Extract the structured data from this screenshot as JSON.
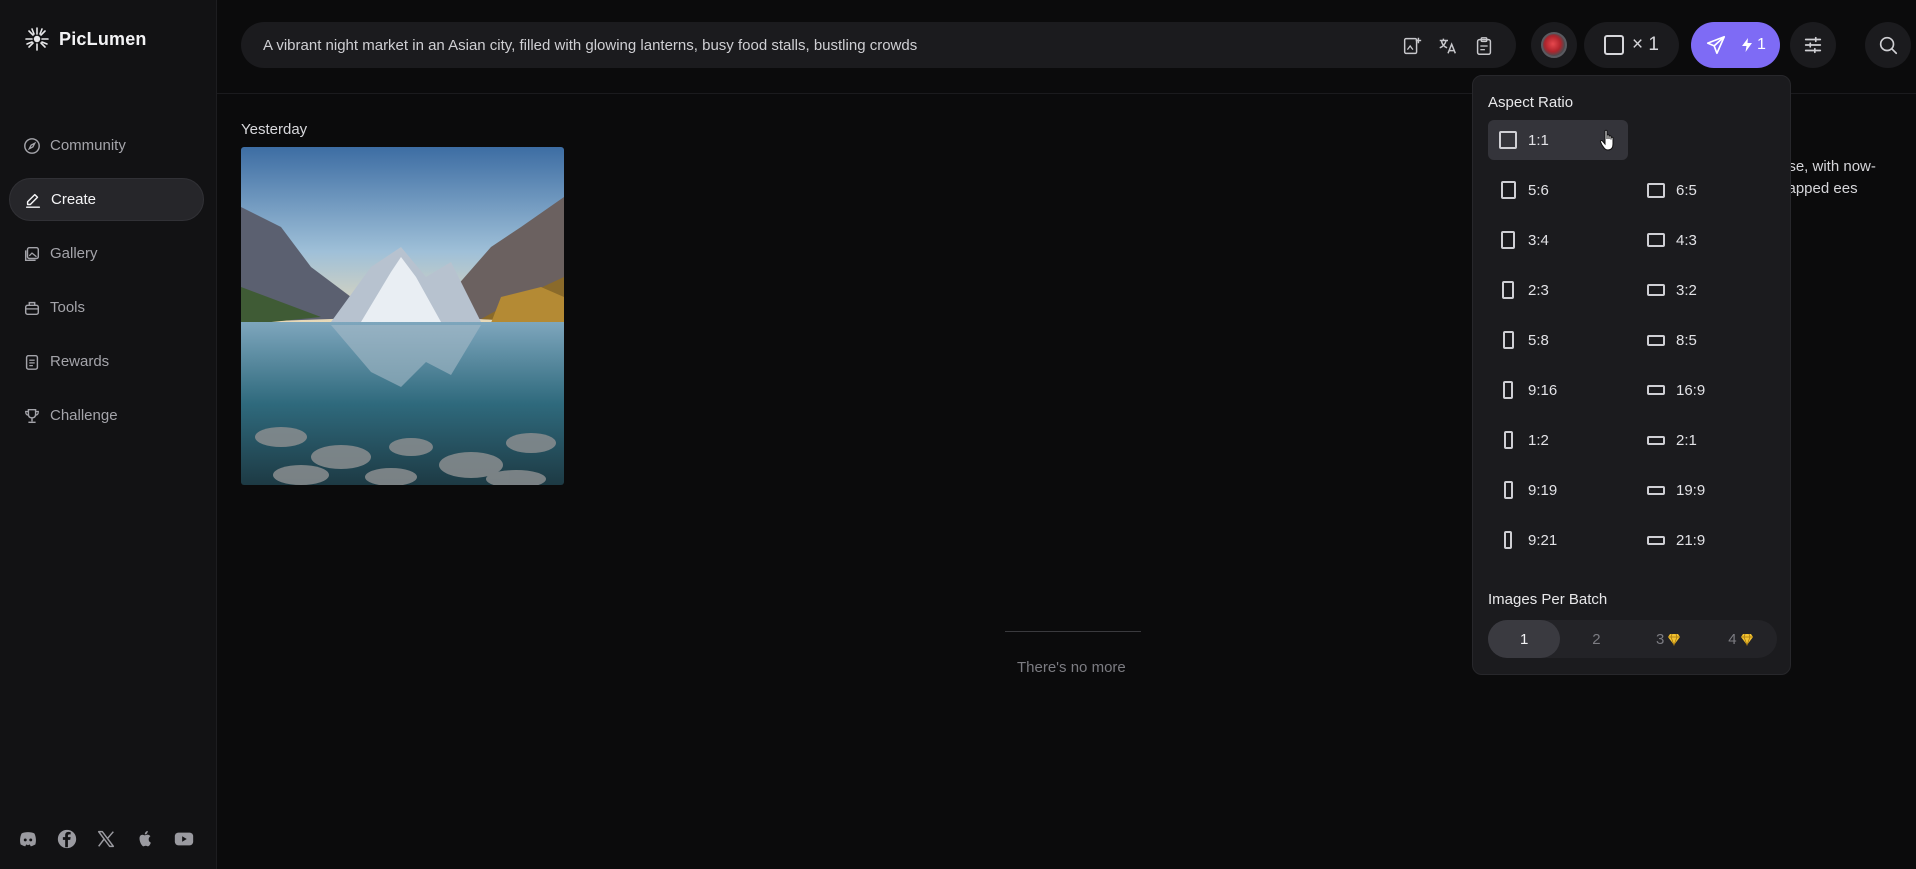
{
  "app": {
    "name": "PicLumen"
  },
  "sidebar": {
    "items": [
      {
        "label": "Community",
        "icon": "compass-icon"
      },
      {
        "label": "Create",
        "icon": "pen-icon",
        "active": true
      },
      {
        "label": "Gallery",
        "icon": "gallery-icon"
      },
      {
        "label": "Tools",
        "icon": "toolbox-icon"
      },
      {
        "label": "Rewards",
        "icon": "clipboard-icon"
      },
      {
        "label": "Challenge",
        "icon": "trophy-icon"
      }
    ],
    "social": [
      "discord-icon",
      "facebook-icon",
      "x-icon",
      "apple-icon",
      "youtube-icon"
    ]
  },
  "prompt": {
    "text": "A vibrant night market in an Asian city, filled with glowing lanterns, busy food stalls, bustling crowds",
    "tools": [
      "image-upload-icon",
      "translate-icon",
      "prompt-doc-icon"
    ]
  },
  "toolbar": {
    "batch_count": "× 1",
    "send_credit": "1",
    "accent_color": "#7e6bf5"
  },
  "main": {
    "date_label": "Yesterday",
    "image_alt": "Mountain lake reflection",
    "end_text": "There's no more",
    "background_prompt_text": "rise, with now-capped ees"
  },
  "dropdown": {
    "aspect_title": "Aspect Ratio",
    "ratios": [
      {
        "label": "1:1",
        "selected": true
      },
      {
        "label": "5:6"
      },
      {
        "label": "6:5"
      },
      {
        "label": "3:4"
      },
      {
        "label": "4:3"
      },
      {
        "label": "2:3"
      },
      {
        "label": "3:2"
      },
      {
        "label": "5:8"
      },
      {
        "label": "8:5"
      },
      {
        "label": "9:16"
      },
      {
        "label": "16:9"
      },
      {
        "label": "1:2"
      },
      {
        "label": "2:1"
      },
      {
        "label": "9:19"
      },
      {
        "label": "19:9"
      },
      {
        "label": "9:21"
      },
      {
        "label": "21:9"
      }
    ],
    "batch_title": "Images Per Batch",
    "batch_options": [
      {
        "label": "1",
        "active": true,
        "premium": false
      },
      {
        "label": "2",
        "premium": false
      },
      {
        "label": "3",
        "premium": true
      },
      {
        "label": "4",
        "premium": true
      }
    ],
    "premium_color": "#f2c230"
  }
}
